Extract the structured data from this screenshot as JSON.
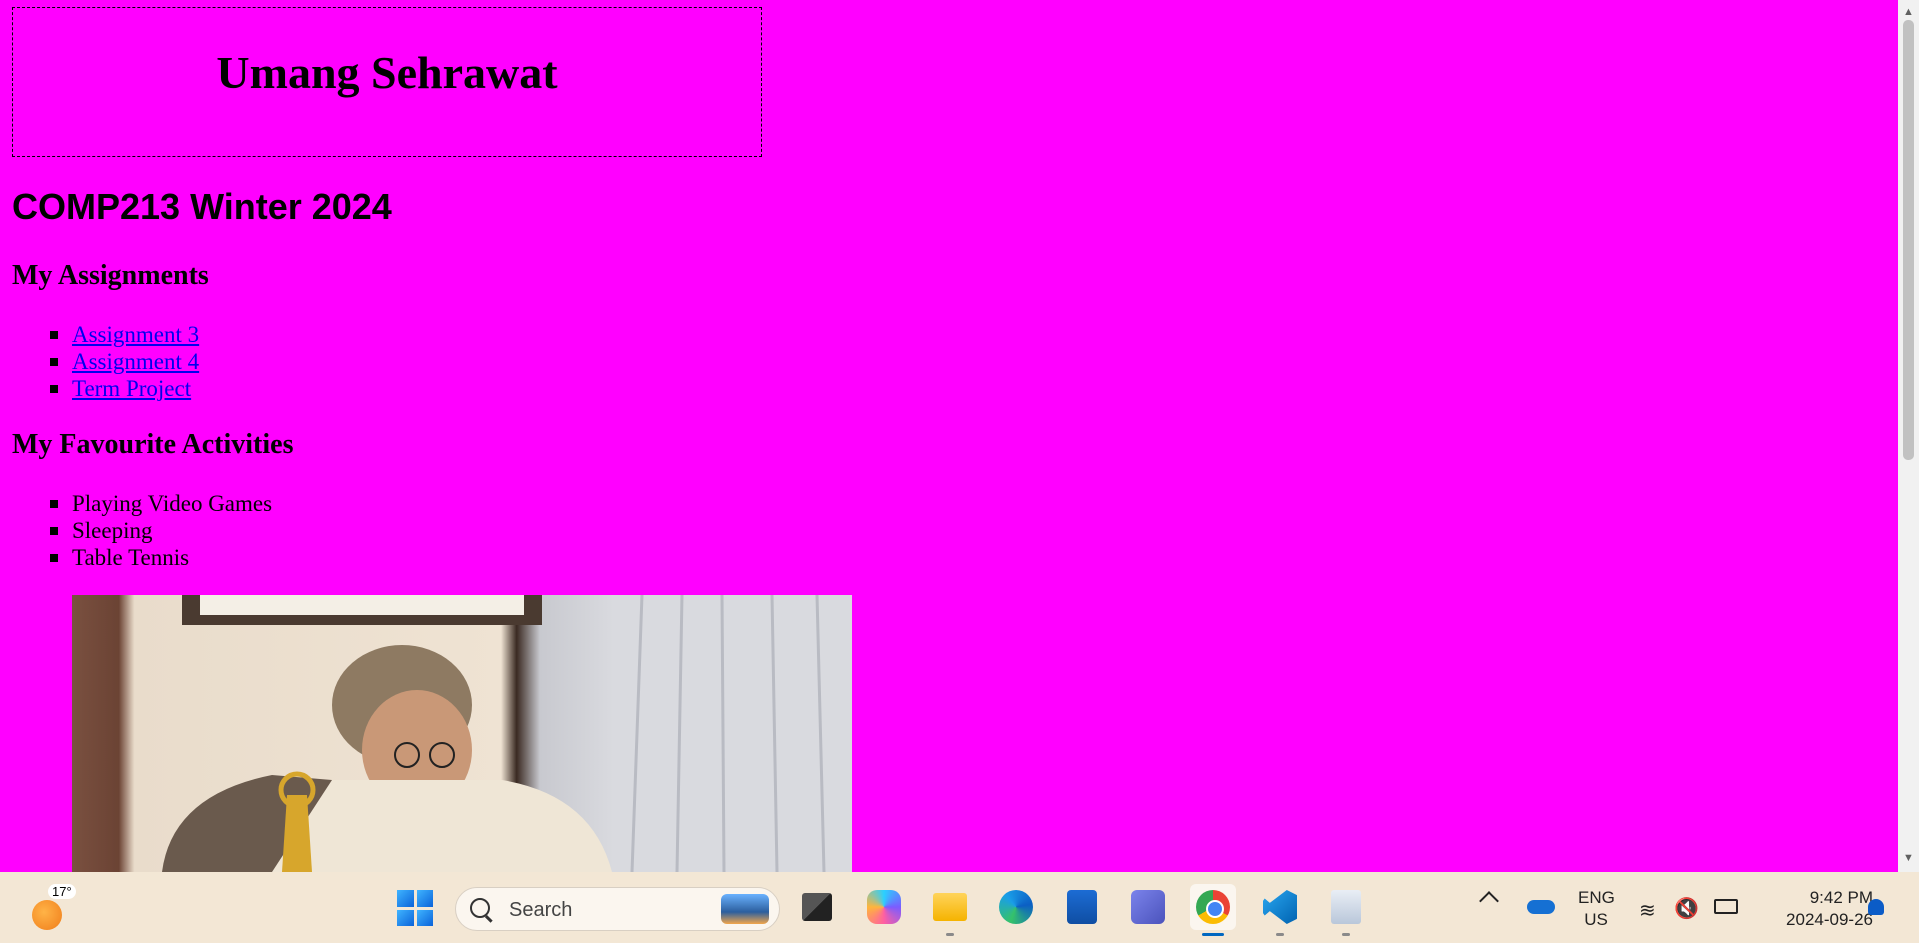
{
  "page": {
    "site_title": "Umang Sehrawat",
    "course_title": "COMP213 Winter 2024",
    "assignments": {
      "heading": "My Assignments",
      "items": [
        "Assignment 3",
        "Assignment 4",
        "Term Project"
      ]
    },
    "activities": {
      "heading": "My Favourite Activities",
      "items": [
        "Playing Video Games",
        "Sleeping",
        "Table Tennis"
      ]
    },
    "background_color": "#ff00ff",
    "link_color": "#0000ee"
  },
  "taskbar": {
    "weather_temp": "17°",
    "search_label": "Search",
    "apps": [
      "task-view",
      "copilot",
      "file-explorer",
      "edge",
      "microsoft-store",
      "teams",
      "chrome",
      "vs-code",
      "notes"
    ],
    "active_app": "chrome",
    "language_line1": "ENG",
    "language_line2": "US",
    "time": "9:42 PM",
    "date": "2024-09-26"
  }
}
